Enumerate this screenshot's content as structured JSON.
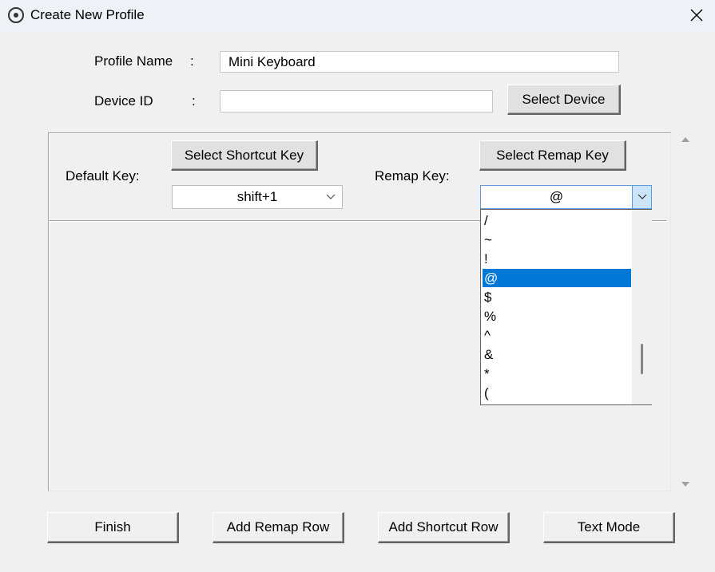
{
  "window": {
    "title": "Create New Profile"
  },
  "form": {
    "profile_name_label": "Profile Name",
    "device_id_label": "Device ID",
    "colon": ":",
    "profile_name_value": "Mini Keyboard",
    "device_id_value": "",
    "select_device_label": "Select Device"
  },
  "mapping": {
    "default_key_label": "Default Key:",
    "remap_key_label": "Remap Key:",
    "select_shortcut_label": "Select Shortcut Key",
    "select_remap_label": "Select Remap Key",
    "default_key_value": "shift+1",
    "remap_key_value": "@",
    "remap_options": [
      "/",
      "~",
      "!",
      "@",
      "$",
      "%",
      "^",
      "&",
      "*",
      "("
    ],
    "remap_selected_index": 3
  },
  "footer": {
    "finish_label": "Finish",
    "add_remap_row_label": "Add Remap Row",
    "add_shortcut_row_label": "Add Shortcut Row",
    "text_mode_label": "Text Mode"
  },
  "colors": {
    "selection": "#0078d7",
    "focus_border": "#569de5"
  }
}
